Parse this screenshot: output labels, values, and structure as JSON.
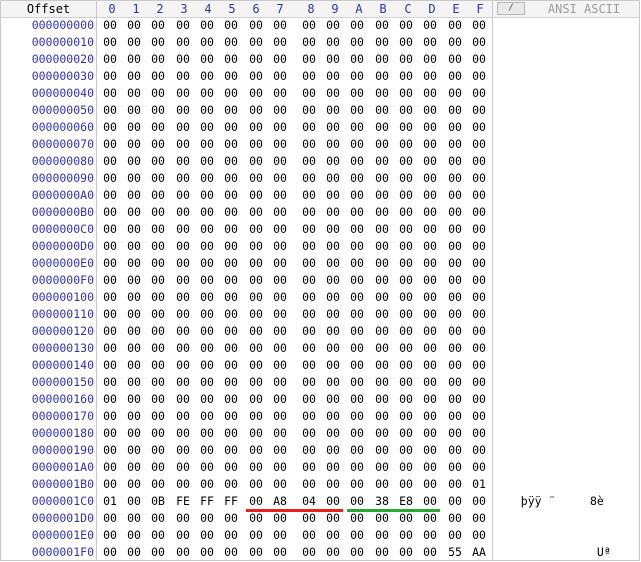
{
  "header": {
    "offset_label": "Offset",
    "hex_columns": [
      "0",
      "1",
      "2",
      "3",
      "4",
      "5",
      "6",
      "7",
      "8",
      "9",
      "A",
      "B",
      "C",
      "D",
      "E",
      "F"
    ],
    "ascii_label": "ANSI ASCII",
    "toggle_button_glyph": "/"
  },
  "rows": [
    {
      "offset": "000000000",
      "bytes": [
        "00",
        "00",
        "00",
        "00",
        "00",
        "00",
        "00",
        "00",
        "00",
        "00",
        "00",
        "00",
        "00",
        "00",
        "00",
        "00"
      ],
      "ascii": ""
    },
    {
      "offset": "000000010",
      "bytes": [
        "00",
        "00",
        "00",
        "00",
        "00",
        "00",
        "00",
        "00",
        "00",
        "00",
        "00",
        "00",
        "00",
        "00",
        "00",
        "00"
      ],
      "ascii": ""
    },
    {
      "offset": "000000020",
      "bytes": [
        "00",
        "00",
        "00",
        "00",
        "00",
        "00",
        "00",
        "00",
        "00",
        "00",
        "00",
        "00",
        "00",
        "00",
        "00",
        "00"
      ],
      "ascii": ""
    },
    {
      "offset": "000000030",
      "bytes": [
        "00",
        "00",
        "00",
        "00",
        "00",
        "00",
        "00",
        "00",
        "00",
        "00",
        "00",
        "00",
        "00",
        "00",
        "00",
        "00"
      ],
      "ascii": ""
    },
    {
      "offset": "000000040",
      "bytes": [
        "00",
        "00",
        "00",
        "00",
        "00",
        "00",
        "00",
        "00",
        "00",
        "00",
        "00",
        "00",
        "00",
        "00",
        "00",
        "00"
      ],
      "ascii": ""
    },
    {
      "offset": "000000050",
      "bytes": [
        "00",
        "00",
        "00",
        "00",
        "00",
        "00",
        "00",
        "00",
        "00",
        "00",
        "00",
        "00",
        "00",
        "00",
        "00",
        "00"
      ],
      "ascii": ""
    },
    {
      "offset": "000000060",
      "bytes": [
        "00",
        "00",
        "00",
        "00",
        "00",
        "00",
        "00",
        "00",
        "00",
        "00",
        "00",
        "00",
        "00",
        "00",
        "00",
        "00"
      ],
      "ascii": ""
    },
    {
      "offset": "000000070",
      "bytes": [
        "00",
        "00",
        "00",
        "00",
        "00",
        "00",
        "00",
        "00",
        "00",
        "00",
        "00",
        "00",
        "00",
        "00",
        "00",
        "00"
      ],
      "ascii": ""
    },
    {
      "offset": "000000080",
      "bytes": [
        "00",
        "00",
        "00",
        "00",
        "00",
        "00",
        "00",
        "00",
        "00",
        "00",
        "00",
        "00",
        "00",
        "00",
        "00",
        "00"
      ],
      "ascii": ""
    },
    {
      "offset": "000000090",
      "bytes": [
        "00",
        "00",
        "00",
        "00",
        "00",
        "00",
        "00",
        "00",
        "00",
        "00",
        "00",
        "00",
        "00",
        "00",
        "00",
        "00"
      ],
      "ascii": ""
    },
    {
      "offset": "0000000A0",
      "bytes": [
        "00",
        "00",
        "00",
        "00",
        "00",
        "00",
        "00",
        "00",
        "00",
        "00",
        "00",
        "00",
        "00",
        "00",
        "00",
        "00"
      ],
      "ascii": ""
    },
    {
      "offset": "0000000B0",
      "bytes": [
        "00",
        "00",
        "00",
        "00",
        "00",
        "00",
        "00",
        "00",
        "00",
        "00",
        "00",
        "00",
        "00",
        "00",
        "00",
        "00"
      ],
      "ascii": ""
    },
    {
      "offset": "0000000C0",
      "bytes": [
        "00",
        "00",
        "00",
        "00",
        "00",
        "00",
        "00",
        "00",
        "00",
        "00",
        "00",
        "00",
        "00",
        "00",
        "00",
        "00"
      ],
      "ascii": ""
    },
    {
      "offset": "0000000D0",
      "bytes": [
        "00",
        "00",
        "00",
        "00",
        "00",
        "00",
        "00",
        "00",
        "00",
        "00",
        "00",
        "00",
        "00",
        "00",
        "00",
        "00"
      ],
      "ascii": ""
    },
    {
      "offset": "0000000E0",
      "bytes": [
        "00",
        "00",
        "00",
        "00",
        "00",
        "00",
        "00",
        "00",
        "00",
        "00",
        "00",
        "00",
        "00",
        "00",
        "00",
        "00"
      ],
      "ascii": ""
    },
    {
      "offset": "0000000F0",
      "bytes": [
        "00",
        "00",
        "00",
        "00",
        "00",
        "00",
        "00",
        "00",
        "00",
        "00",
        "00",
        "00",
        "00",
        "00",
        "00",
        "00"
      ],
      "ascii": ""
    },
    {
      "offset": "000000100",
      "bytes": [
        "00",
        "00",
        "00",
        "00",
        "00",
        "00",
        "00",
        "00",
        "00",
        "00",
        "00",
        "00",
        "00",
        "00",
        "00",
        "00"
      ],
      "ascii": ""
    },
    {
      "offset": "000000110",
      "bytes": [
        "00",
        "00",
        "00",
        "00",
        "00",
        "00",
        "00",
        "00",
        "00",
        "00",
        "00",
        "00",
        "00",
        "00",
        "00",
        "00"
      ],
      "ascii": ""
    },
    {
      "offset": "000000120",
      "bytes": [
        "00",
        "00",
        "00",
        "00",
        "00",
        "00",
        "00",
        "00",
        "00",
        "00",
        "00",
        "00",
        "00",
        "00",
        "00",
        "00"
      ],
      "ascii": ""
    },
    {
      "offset": "000000130",
      "bytes": [
        "00",
        "00",
        "00",
        "00",
        "00",
        "00",
        "00",
        "00",
        "00",
        "00",
        "00",
        "00",
        "00",
        "00",
        "00",
        "00"
      ],
      "ascii": ""
    },
    {
      "offset": "000000140",
      "bytes": [
        "00",
        "00",
        "00",
        "00",
        "00",
        "00",
        "00",
        "00",
        "00",
        "00",
        "00",
        "00",
        "00",
        "00",
        "00",
        "00"
      ],
      "ascii": ""
    },
    {
      "offset": "000000150",
      "bytes": [
        "00",
        "00",
        "00",
        "00",
        "00",
        "00",
        "00",
        "00",
        "00",
        "00",
        "00",
        "00",
        "00",
        "00",
        "00",
        "00"
      ],
      "ascii": ""
    },
    {
      "offset": "000000160",
      "bytes": [
        "00",
        "00",
        "00",
        "00",
        "00",
        "00",
        "00",
        "00",
        "00",
        "00",
        "00",
        "00",
        "00",
        "00",
        "00",
        "00"
      ],
      "ascii": ""
    },
    {
      "offset": "000000170",
      "bytes": [
        "00",
        "00",
        "00",
        "00",
        "00",
        "00",
        "00",
        "00",
        "00",
        "00",
        "00",
        "00",
        "00",
        "00",
        "00",
        "00"
      ],
      "ascii": ""
    },
    {
      "offset": "000000180",
      "bytes": [
        "00",
        "00",
        "00",
        "00",
        "00",
        "00",
        "00",
        "00",
        "00",
        "00",
        "00",
        "00",
        "00",
        "00",
        "00",
        "00"
      ],
      "ascii": ""
    },
    {
      "offset": "000000190",
      "bytes": [
        "00",
        "00",
        "00",
        "00",
        "00",
        "00",
        "00",
        "00",
        "00",
        "00",
        "00",
        "00",
        "00",
        "00",
        "00",
        "00"
      ],
      "ascii": ""
    },
    {
      "offset": "0000001A0",
      "bytes": [
        "00",
        "00",
        "00",
        "00",
        "00",
        "00",
        "00",
        "00",
        "00",
        "00",
        "00",
        "00",
        "00",
        "00",
        "00",
        "00"
      ],
      "ascii": ""
    },
    {
      "offset": "0000001B0",
      "bytes": [
        "00",
        "00",
        "00",
        "00",
        "00",
        "00",
        "00",
        "00",
        "00",
        "00",
        "00",
        "00",
        "00",
        "00",
        "00",
        "01"
      ],
      "ascii": ""
    },
    {
      "offset": "0000001C0",
      "bytes": [
        "01",
        "00",
        "0B",
        "FE",
        "FF",
        "FF",
        "00",
        "A8",
        "04",
        "00",
        "00",
        "38",
        "E8",
        "00",
        "00",
        "00"
      ],
      "ascii": "   þÿÿ ¨     8è"
    },
    {
      "offset": "0000001D0",
      "bytes": [
        "00",
        "00",
        "00",
        "00",
        "00",
        "00",
        "00",
        "00",
        "00",
        "00",
        "00",
        "00",
        "00",
        "00",
        "00",
        "00"
      ],
      "ascii": ""
    },
    {
      "offset": "0000001E0",
      "bytes": [
        "00",
        "00",
        "00",
        "00",
        "00",
        "00",
        "00",
        "00",
        "00",
        "00",
        "00",
        "00",
        "00",
        "00",
        "00",
        "00"
      ],
      "ascii": ""
    },
    {
      "offset": "0000001F0",
      "bytes": [
        "00",
        "00",
        "00",
        "00",
        "00",
        "00",
        "00",
        "00",
        "00",
        "00",
        "00",
        "00",
        "00",
        "00",
        "55",
        "AA"
      ],
      "ascii": "              Uª"
    }
  ],
  "highlights": [
    {
      "row": 28,
      "from_col": 6,
      "to_col": 9,
      "color": "#e8201e"
    },
    {
      "row": 28,
      "from_col": 10,
      "to_col": 13,
      "color": "#2aa832"
    }
  ]
}
